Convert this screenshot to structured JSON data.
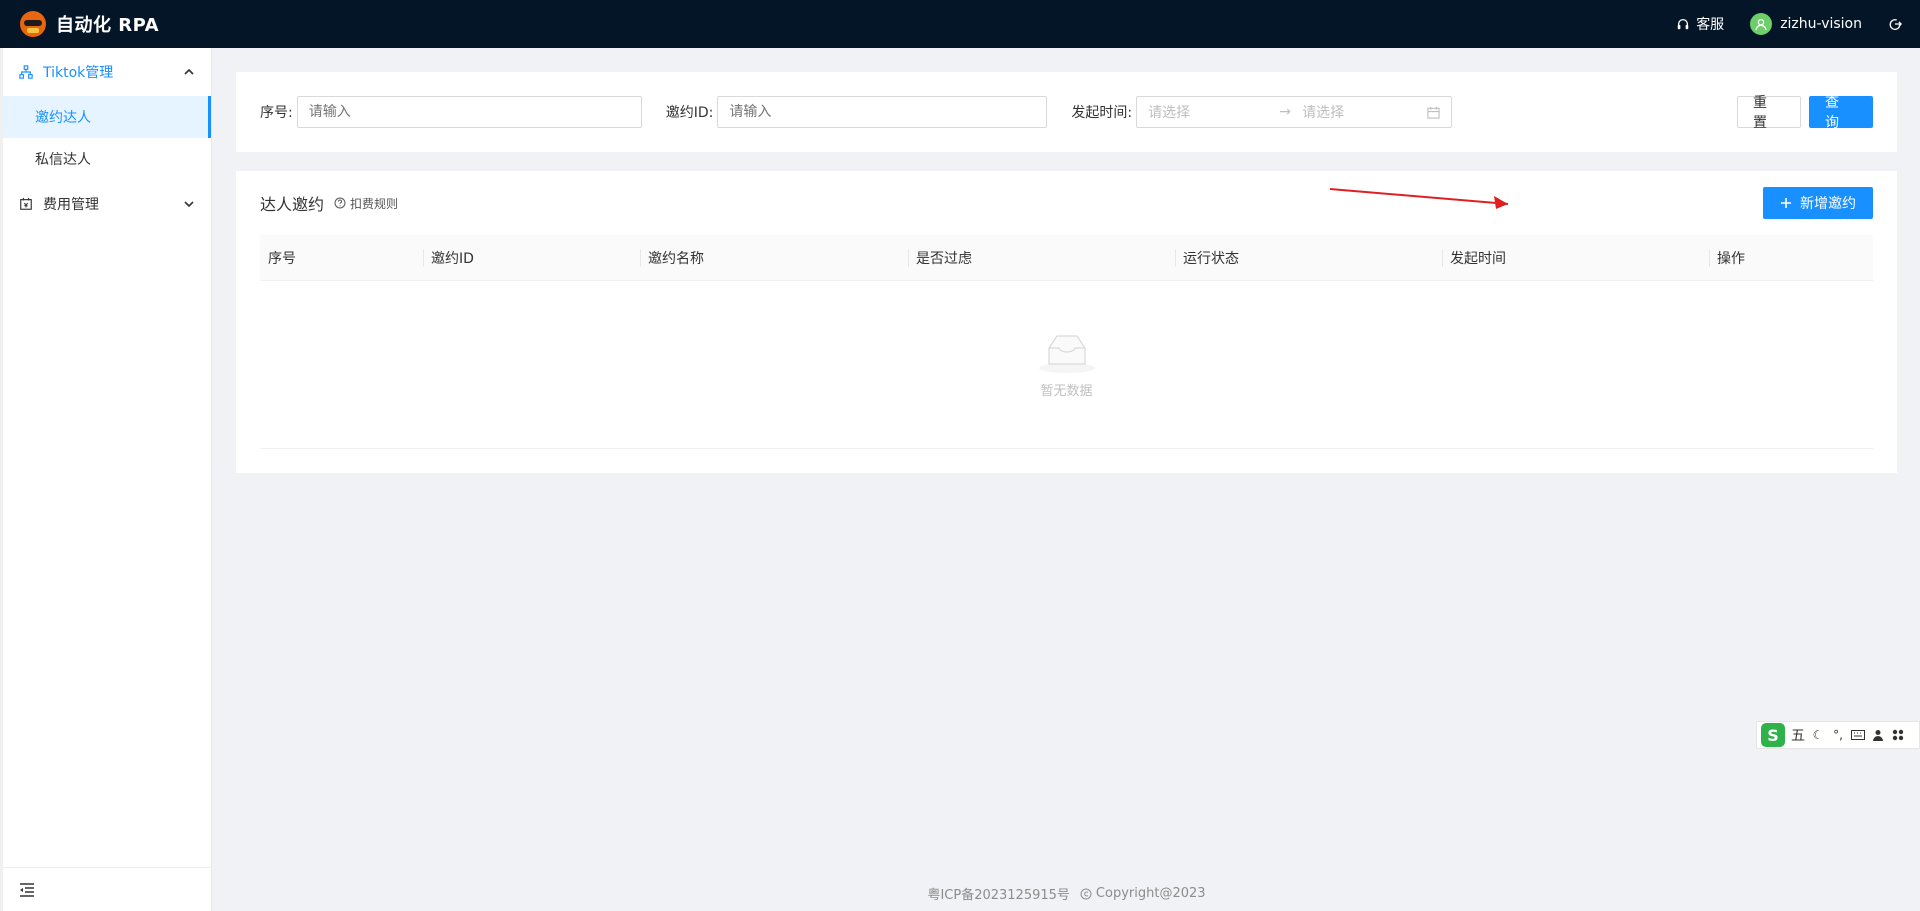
{
  "header": {
    "app_title": "自动化 RPA",
    "support_label": "客服",
    "username": "zizhu-vision"
  },
  "sidebar": {
    "groups": [
      {
        "label": "Tiktok管理",
        "expanded": true,
        "items": [
          {
            "label": "邀约达人",
            "active": true
          },
          {
            "label": "私信达人",
            "active": false
          }
        ]
      },
      {
        "label": "费用管理",
        "expanded": false,
        "items": []
      }
    ]
  },
  "filter": {
    "serial_label": "序号:",
    "serial_placeholder": "请输入",
    "invite_id_label": "邀约ID:",
    "invite_id_placeholder": "请输入",
    "start_time_label": "发起时间:",
    "start_placeholder": "请选择",
    "end_placeholder": "请选择",
    "reset_label": "重 置",
    "query_label": "查 询"
  },
  "table": {
    "title": "达人邀约",
    "rule_link": "扣费规则",
    "add_button": "新增邀约",
    "columns": [
      "序号",
      "邀约ID",
      "邀约名称",
      "是否过虑",
      "运行状态",
      "发起时间",
      "操作"
    ],
    "empty_text": "暂无数据"
  },
  "footer": {
    "icp": "粤ICP备2023125915号",
    "copyright": "Copyright@2023"
  },
  "ime": {
    "mode": "五"
  },
  "colors": {
    "header_bg": "#041527",
    "primary": "#1890ff",
    "annotation_arrow": "#e02020"
  }
}
